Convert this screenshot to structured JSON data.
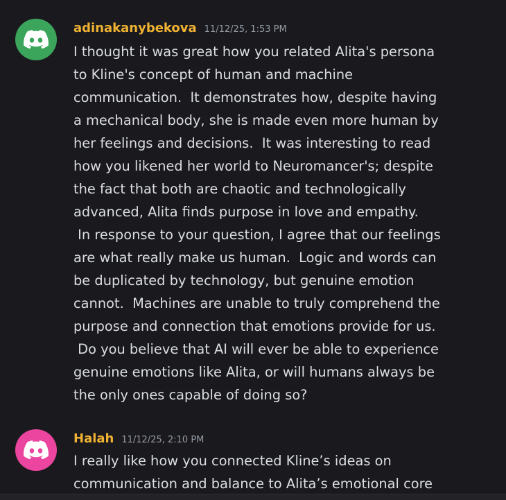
{
  "messages": [
    {
      "username": "adinakanybekova",
      "username_color": "#f0b232",
      "timestamp": "11/12/25, 1:53 PM",
      "avatar_icon": "discord-logo-icon",
      "avatar_color": "#3ba55c",
      "lines": [
        "I thought it was great how you related Alita's persona",
        "to Kline's concept of human and machine",
        "communication.  It demonstrates how, despite having",
        "a mechanical body, she is made even more human by",
        "her feelings and decisions.  It was interesting to read",
        "how you likened her world to Neuromancer's; despite",
        "the fact that both are chaotic and technologically",
        "advanced, Alita finds purpose in love and empathy.",
        " In response to your question, I agree that our feelings",
        "are what really make us human.  Logic and words can",
        "be duplicated by technology, but genuine emotion",
        "cannot.  Machines are unable to truly comprehend the",
        "purpose and connection that emotions provide for us.",
        " Do you believe that AI will ever be able to experience",
        "genuine emotions like Alita, or will humans always be",
        "the only ones capable of doing so?"
      ]
    },
    {
      "username": "Halah",
      "username_color": "#f0b232",
      "timestamp": "11/12/25, 2:10 PM",
      "avatar_icon": "discord-logo-icon",
      "avatar_color": "#eb459f",
      "lines": [
        "I really like how you connected Kline’s ideas on",
        "communication and balance to Alita’s emotional core"
      ]
    }
  ]
}
